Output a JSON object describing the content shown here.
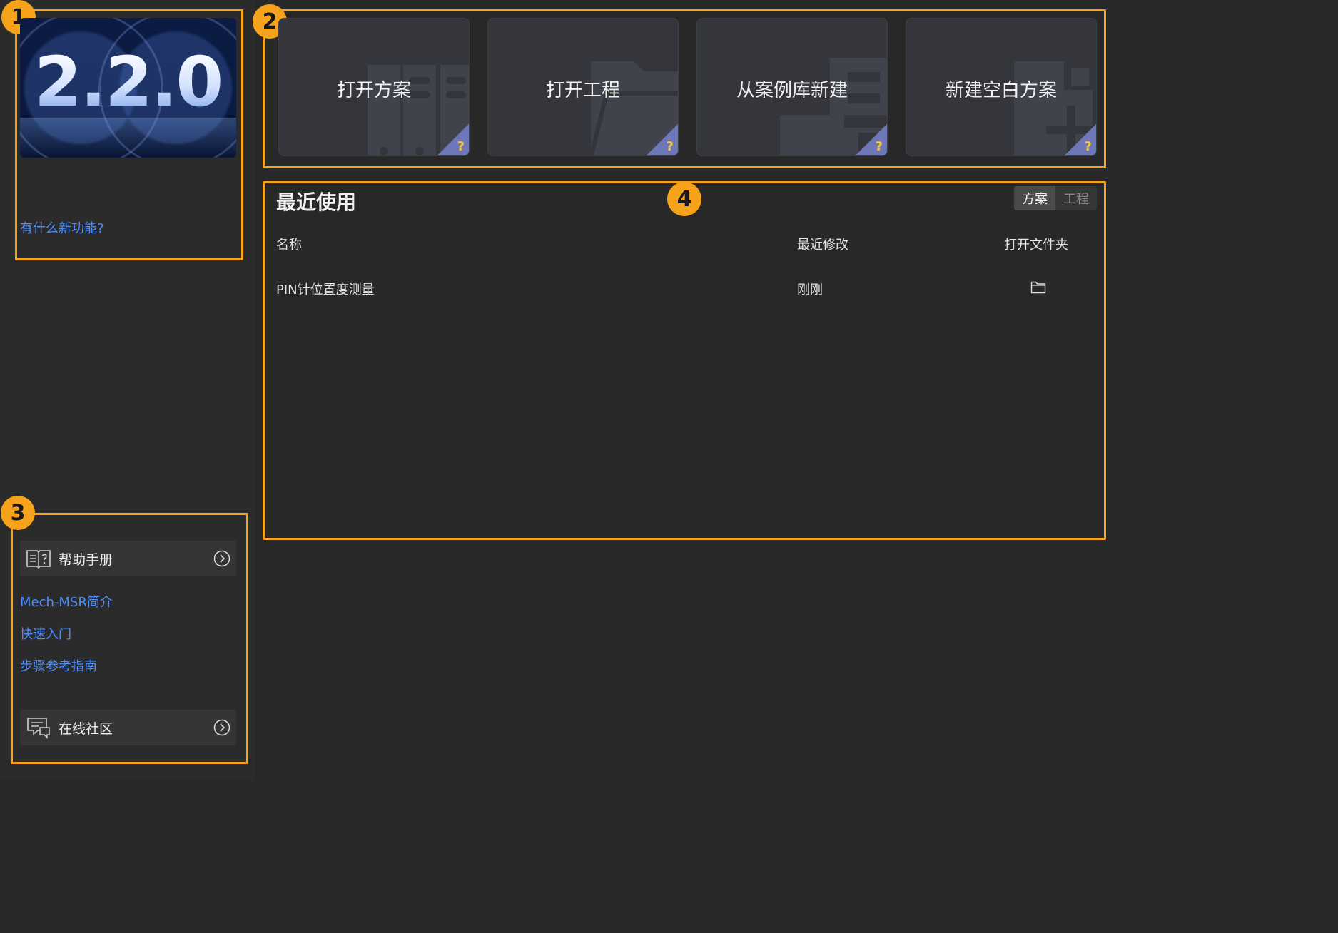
{
  "banner": {
    "version": "2.2.0"
  },
  "whats_new": "有什么新功能?",
  "markers": [
    "1",
    "2",
    "3",
    "4"
  ],
  "actions": [
    {
      "label": "打开方案",
      "help": "?"
    },
    {
      "label": "打开工程",
      "help": "?"
    },
    {
      "label": "从案例库新建",
      "help": "?"
    },
    {
      "label": "新建空白方案",
      "help": "?"
    }
  ],
  "recent": {
    "title": "最近使用",
    "toggle": [
      "方案",
      "工程"
    ],
    "toggle_active": "方案",
    "columns": [
      "名称",
      "最近修改",
      "打开文件夹"
    ],
    "rows": [
      {
        "name": "PIN针位置度测量",
        "modified": "刚刚"
      }
    ]
  },
  "help": {
    "manual": "帮助手册",
    "links": [
      "Mech-MSR简介",
      "快速入门",
      "步骤参考指南"
    ],
    "community": "在线社区"
  }
}
